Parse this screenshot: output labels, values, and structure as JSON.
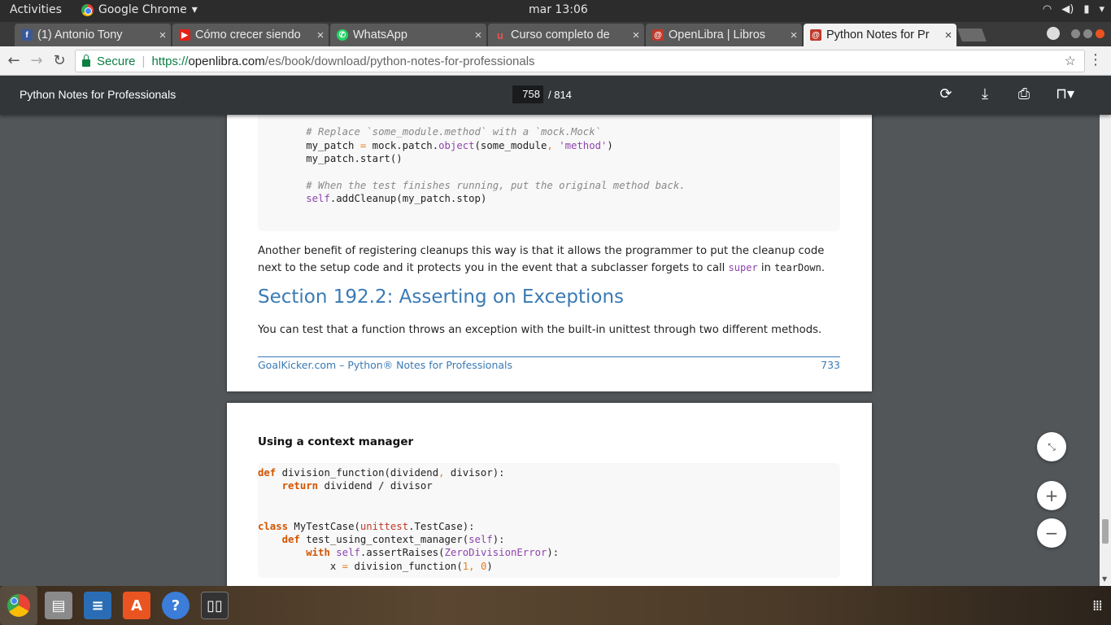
{
  "topbar": {
    "activities": "Activities",
    "app": "Google Chrome",
    "clock": "mar 13:06"
  },
  "tabs": [
    {
      "title": "(1) Antonio Tony",
      "favicon": "facebook-icon",
      "color": "#3b5998"
    },
    {
      "title": "Cómo crecer siendo",
      "favicon": "youtube-icon",
      "color": "#e62117"
    },
    {
      "title": "WhatsApp",
      "favicon": "whatsapp-icon",
      "color": "#25d366"
    },
    {
      "title": "Curso completo de",
      "favicon": "udemy-icon",
      "color": "#ec5252"
    },
    {
      "title": "OpenLibra | Libros",
      "favicon": "openlibra-icon",
      "color": "#c0392b"
    },
    {
      "title": "Python Notes for Pr",
      "favicon": "openlibra-icon",
      "color": "#c0392b"
    }
  ],
  "address": {
    "secure": "Secure",
    "scheme": "https://",
    "host": "openlibra.com",
    "path": "/es/book/download/python-notes-for-professionals"
  },
  "pdf": {
    "title": "Python Notes for Professionals",
    "current_page": "758",
    "total_pages": "/ 814"
  },
  "page1": {
    "para1_a": "Another benefit of registering cleanups this way is that it allows the programmer to put the cleanup code next to the setup code and it protects you in the event that a subclasser forgets to call ",
    "para1_super": "super",
    "para1_in": " in ",
    "para1_teardown": "tearDown",
    "para1_end": ".",
    "section_title": "Section 192.2: Asserting on Exceptions",
    "para2": "You can test that a function throws an exception with the built-in unittest through two different methods.",
    "footer_left": "GoalKicker.com – Python® Notes for Professionals",
    "footer_right": "733"
  },
  "page2": {
    "subhead": "Using a context manager"
  },
  "fabs": {
    "zoom_in": "+",
    "zoom_out": "−"
  }
}
